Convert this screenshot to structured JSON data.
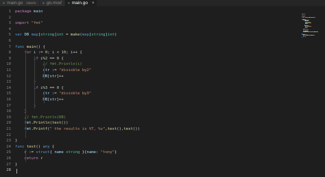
{
  "tabs": [
    {
      "icon": "go",
      "label": "main.go",
      "desc": "labels",
      "active": false,
      "close": ""
    },
    {
      "icon": "go",
      "label": "go.mod",
      "desc": "",
      "active": false,
      "close": ""
    },
    {
      "icon": "go",
      "label": "main.go",
      "desc": "",
      "active": true,
      "close": "×"
    }
  ],
  "editor": {
    "active_line": "28",
    "lines": [
      {
        "n": "1",
        "t": [
          [
            "kw",
            "package"
          ],
          [
            "op",
            " "
          ],
          [
            "id",
            "main"
          ]
        ]
      },
      {
        "n": "2",
        "t": []
      },
      {
        "n": "3",
        "t": [
          [
            "kw",
            "import"
          ],
          [
            "op",
            " "
          ],
          [
            "str",
            "\"fmt\""
          ]
        ]
      },
      {
        "n": "4",
        "t": []
      },
      {
        "n": "5",
        "t": [
          [
            "kw2",
            "var"
          ],
          [
            "op",
            " "
          ],
          [
            "id",
            "DB"
          ],
          [
            "op",
            " "
          ],
          [
            "kw2",
            "map"
          ],
          [
            "op",
            "["
          ],
          [
            "typ",
            "string"
          ],
          [
            "op",
            "]"
          ],
          [
            "typ",
            "int"
          ],
          [
            "op",
            " = "
          ],
          [
            "fn",
            "make"
          ],
          [
            "op",
            "("
          ],
          [
            "kw2",
            "map"
          ],
          [
            "op",
            "["
          ],
          [
            "typ",
            "string"
          ],
          [
            "op",
            "]"
          ],
          [
            "typ",
            "int"
          ],
          [
            "op",
            ")"
          ]
        ]
      },
      {
        "n": "6",
        "t": []
      },
      {
        "n": "7",
        "t": [
          [
            "kw2",
            "func"
          ],
          [
            "op",
            " "
          ],
          [
            "fn",
            "main"
          ],
          [
            "op",
            "() {"
          ]
        ]
      },
      {
        "n": "8",
        "t": [
          [
            "op",
            "    "
          ],
          [
            "kw",
            "for"
          ],
          [
            "op",
            " "
          ],
          [
            "id",
            "i"
          ],
          [
            "op",
            " := "
          ],
          [
            "num",
            "0"
          ],
          [
            "op",
            "; "
          ],
          [
            "id",
            "i"
          ],
          [
            "op",
            " < "
          ],
          [
            "num",
            "10"
          ],
          [
            "op",
            "; "
          ],
          [
            "id",
            "i"
          ],
          [
            "op",
            "++ {"
          ]
        ]
      },
      {
        "n": "9",
        "t": [
          [
            "op",
            "        "
          ],
          [
            "kw",
            "if"
          ],
          [
            "op",
            " "
          ],
          [
            "id",
            "i"
          ],
          [
            "op",
            "%"
          ],
          [
            "num",
            "2"
          ],
          [
            "op",
            " == "
          ],
          [
            "num",
            "0"
          ],
          [
            "op",
            " {"
          ]
        ]
      },
      {
        "n": "10",
        "t": [
          [
            "op",
            "            "
          ],
          [
            "cmt",
            "// fmt.Println(i)"
          ]
        ]
      },
      {
        "n": "11",
        "t": [
          [
            "op",
            "            "
          ],
          [
            "id",
            "str"
          ],
          [
            "op",
            " := "
          ],
          [
            "str",
            "\"divisble by2\""
          ]
        ]
      },
      {
        "n": "12",
        "t": [
          [
            "op",
            "            "
          ],
          [
            "id",
            "DB"
          ],
          [
            "op",
            "["
          ],
          [
            "id",
            "str"
          ],
          [
            "op",
            "]++"
          ]
        ]
      },
      {
        "n": "13",
        "t": [
          [
            "op",
            "        }"
          ]
        ]
      },
      {
        "n": "14",
        "t": [
          [
            "op",
            "        "
          ],
          [
            "kw",
            "if"
          ],
          [
            "op",
            " "
          ],
          [
            "id",
            "i"
          ],
          [
            "op",
            "%"
          ],
          [
            "num",
            "3"
          ],
          [
            "op",
            " == "
          ],
          [
            "num",
            "0"
          ],
          [
            "op",
            " {"
          ]
        ]
      },
      {
        "n": "15",
        "t": [
          [
            "op",
            "            "
          ],
          [
            "id",
            "str"
          ],
          [
            "op",
            " := "
          ],
          [
            "str",
            "\"divisble by3\""
          ]
        ]
      },
      {
        "n": "16",
        "t": [
          [
            "op",
            "            "
          ],
          [
            "id",
            "DB"
          ],
          [
            "op",
            "["
          ],
          [
            "id",
            "str"
          ],
          [
            "op",
            "]++"
          ]
        ]
      },
      {
        "n": "17",
        "t": [
          [
            "op",
            "        }"
          ]
        ]
      },
      {
        "n": "18",
        "t": [
          [
            "op",
            "    }"
          ]
        ]
      },
      {
        "n": "19",
        "t": [
          [
            "op",
            "    "
          ],
          [
            "cmt",
            "// fmt.Println(DB)"
          ]
        ]
      },
      {
        "n": "20",
        "t": [
          [
            "op",
            "    "
          ],
          [
            "id",
            "fmt"
          ],
          [
            "op",
            "."
          ],
          [
            "fn",
            "Println"
          ],
          [
            "op",
            "("
          ],
          [
            "fn",
            "test"
          ],
          [
            "op",
            "())"
          ]
        ]
      },
      {
        "n": "21",
        "t": [
          [
            "op",
            "    "
          ],
          [
            "id",
            "fmt"
          ],
          [
            "op",
            "."
          ],
          [
            "fn",
            "Printf"
          ],
          [
            "op",
            "("
          ],
          [
            "str",
            "\" the results is %T, %v\""
          ],
          [
            "op",
            ","
          ],
          [
            "fn",
            "test"
          ],
          [
            "op",
            "(),"
          ],
          [
            "fn",
            "test"
          ],
          [
            "op",
            "())"
          ]
        ]
      },
      {
        "n": "22",
        "t": []
      },
      {
        "n": "23",
        "t": [
          [
            "op",
            "}"
          ]
        ]
      },
      {
        "n": "24",
        "t": [
          [
            "kw2",
            "func"
          ],
          [
            "op",
            " "
          ],
          [
            "fn",
            "test"
          ],
          [
            "op",
            "() "
          ],
          [
            "kw2",
            "any"
          ],
          [
            "op",
            " {"
          ]
        ]
      },
      {
        "n": "25",
        "t": [
          [
            "op",
            "    "
          ],
          [
            "id",
            "r"
          ],
          [
            "op",
            " := "
          ],
          [
            "kw2",
            "struct"
          ],
          [
            "op",
            "{ "
          ],
          [
            "id",
            "name"
          ],
          [
            "op",
            " "
          ],
          [
            "typ",
            "string"
          ],
          [
            "op",
            " }{"
          ],
          [
            "id",
            "name"
          ],
          [
            "op",
            ": "
          ],
          [
            "str",
            "\"tony\""
          ],
          [
            "op",
            "}"
          ]
        ]
      },
      {
        "n": "26",
        "t": [
          [
            "op",
            "    "
          ],
          [
            "kw",
            "return"
          ],
          [
            "op",
            " "
          ],
          [
            "id",
            "r"
          ]
        ]
      },
      {
        "n": "27",
        "t": [
          [
            "op",
            "}"
          ]
        ]
      },
      {
        "n": "28",
        "t": []
      }
    ]
  },
  "colors": {
    "background": "#1e1e1e",
    "tabbar": "#252526",
    "keyword": "#c586c0",
    "keyword2": "#569cd6",
    "identifier": "#9cdcfe",
    "function": "#dcdcaa",
    "string": "#ce9178",
    "number": "#b5cea8",
    "comment": "#6a9955",
    "type": "#4ec9b0"
  }
}
